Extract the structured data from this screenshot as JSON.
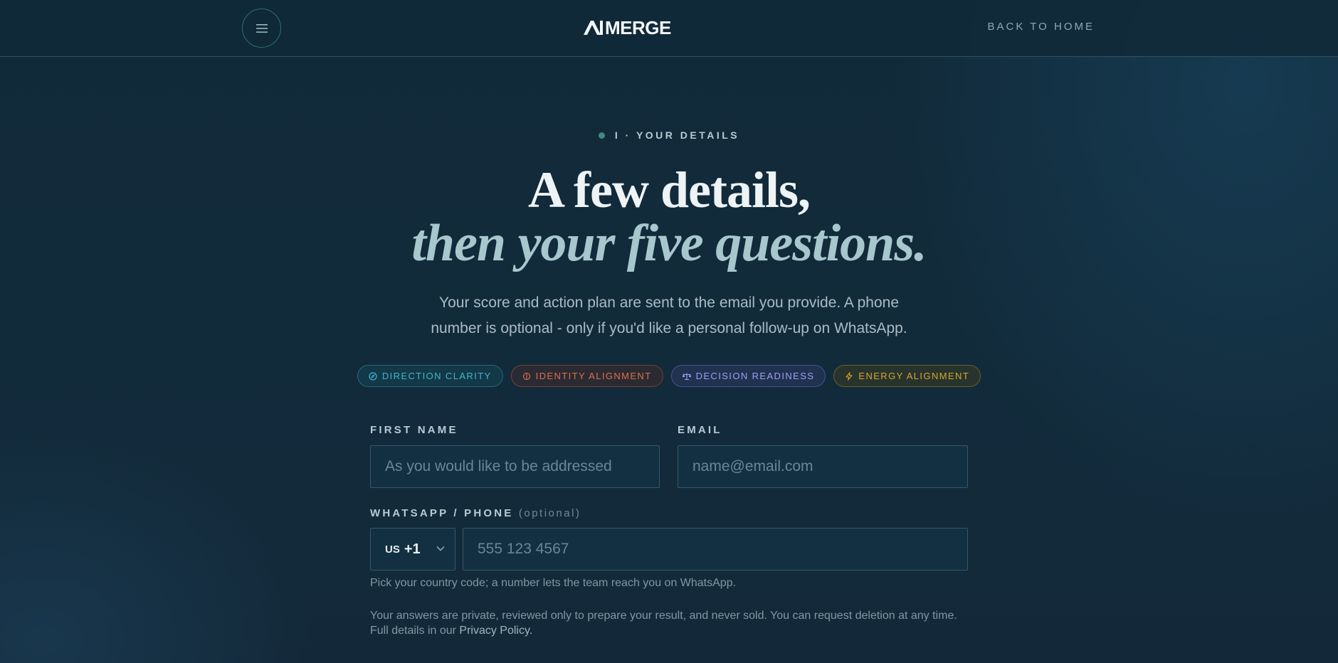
{
  "header": {
    "logo_text": "MERGE",
    "back_link": "BACK TO HOME"
  },
  "step": {
    "label": "I · YOUR DETAILS"
  },
  "headline": {
    "line1": "A few details,",
    "line2": "then your five questions."
  },
  "intro": "Your score and action plan are sent to the email you provide. A phone number is optional - only if you'd like a personal follow-up on WhatsApp.",
  "pills": [
    {
      "label": "DIRECTION CLARITY",
      "icon": "compass-icon",
      "color": "#3fb6cc"
    },
    {
      "label": "IDENTITY ALIGNMENT",
      "icon": "brain-icon",
      "color": "#e36d4c"
    },
    {
      "label": "DECISION READINESS",
      "icon": "scale-icon",
      "color": "#9e9ff0"
    },
    {
      "label": "ENERGY ALIGNMENT",
      "icon": "bolt-icon",
      "color": "#d9a52d"
    }
  ],
  "form": {
    "first_name": {
      "label": "FIRST NAME",
      "placeholder": "As you would like to be addressed",
      "value": ""
    },
    "email": {
      "label": "EMAIL",
      "placeholder": "name@email.com",
      "value": ""
    },
    "phone": {
      "label": "WHATSAPP / PHONE",
      "optional": "(optional)",
      "country_code": "US",
      "dial_code": "+1",
      "placeholder": "555 123 4567",
      "value": "",
      "hint": "Pick your country code; a number lets the team reach you on WhatsApp."
    },
    "privacy_text": "Your answers are private, reviewed only to prepare your result, and never sold. You can request deletion at any time. Full details in our",
    "privacy_link": "Privacy Policy."
  }
}
